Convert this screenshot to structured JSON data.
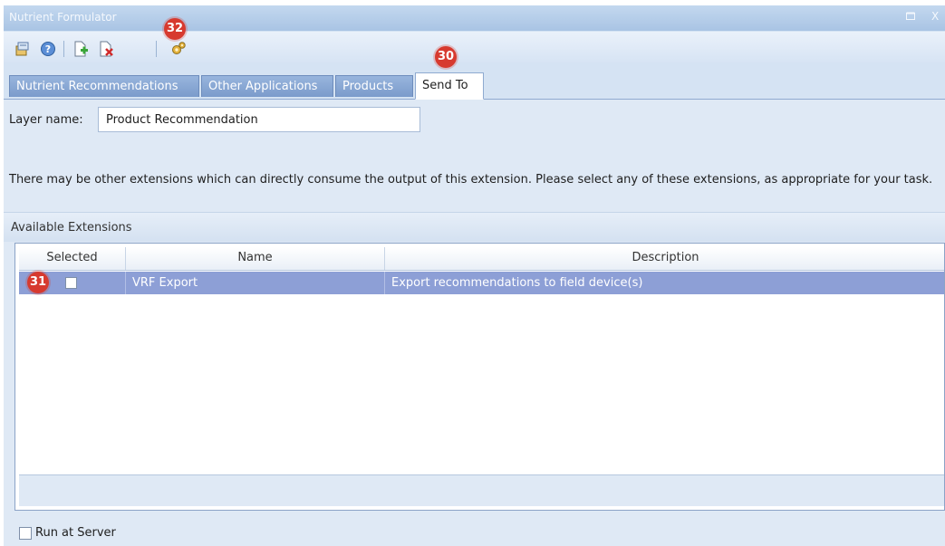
{
  "window": {
    "title": "Nutrient Formulator",
    "restore_icon": "restore-icon",
    "close_glyph": "X"
  },
  "toolbar": {
    "icons": [
      "properties-icon",
      "help-icon",
      "add-document-icon",
      "delete-document-icon",
      "extensions-gear-icon"
    ]
  },
  "tabs": [
    {
      "label": "Nutrient Recommendations",
      "active": false
    },
    {
      "label": "Other Applications",
      "active": false
    },
    {
      "label": "Products",
      "active": false
    },
    {
      "label": "Send To",
      "active": true
    }
  ],
  "layer": {
    "label": "Layer name:",
    "value": "Product Recommendation"
  },
  "info_text": "There may be other extensions which can directly consume the output of this extension.  Please select any of these extensions, as appropriate for your task.",
  "extensions": {
    "section_label": "Available Extensions",
    "columns": [
      "Selected",
      "Name",
      "Description"
    ],
    "rows": [
      {
        "selected": false,
        "name": "VRF Export",
        "description": "Export recommendations to field device(s)"
      }
    ]
  },
  "run_at_server": {
    "label": "Run at Server",
    "checked": false
  },
  "annotations": [
    "32",
    "30",
    "31"
  ],
  "colors": {
    "titlebar": "#a9c4e4",
    "tab_inactive": "#7b9bcb",
    "selected_row": "#8d9fd6",
    "badge": "#d73a2f"
  }
}
